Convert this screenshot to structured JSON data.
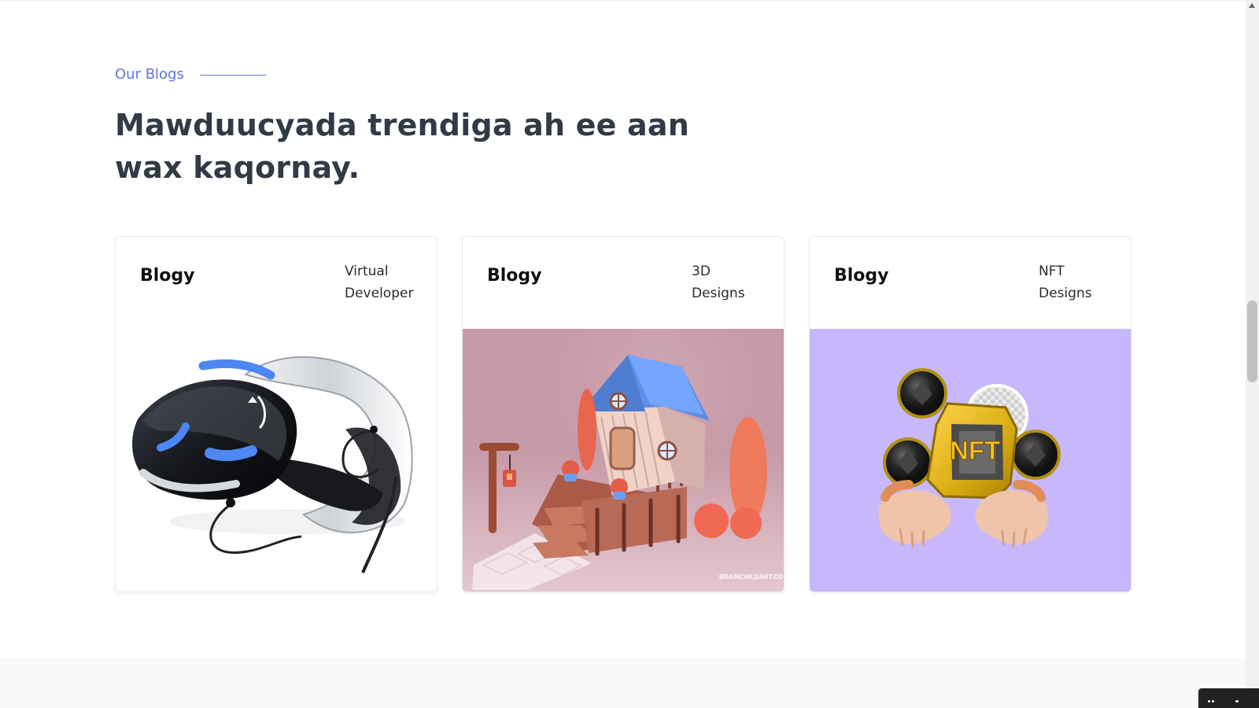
{
  "section": {
    "label": "Our Blogs",
    "title": "Mawduucyada trendiga ah ee aan wax kaqornay."
  },
  "cards": [
    {
      "brand": "Blogy",
      "category": "Virtual Developer",
      "image_icon": "vr-headset-icon"
    },
    {
      "brand": "Blogy",
      "category": "3D Designs",
      "image_icon": "house-scene-icon",
      "watermark": "BRAINCHILDART.CO"
    },
    {
      "brand": "Blogy",
      "category": "NFT Designs",
      "image_icon": "nft-hands-icon"
    }
  ],
  "colors": {
    "accent": "#5b78d9",
    "heading": "#313a46",
    "nft_background": "#c7b8fb",
    "house_background": "#c79aa8"
  }
}
